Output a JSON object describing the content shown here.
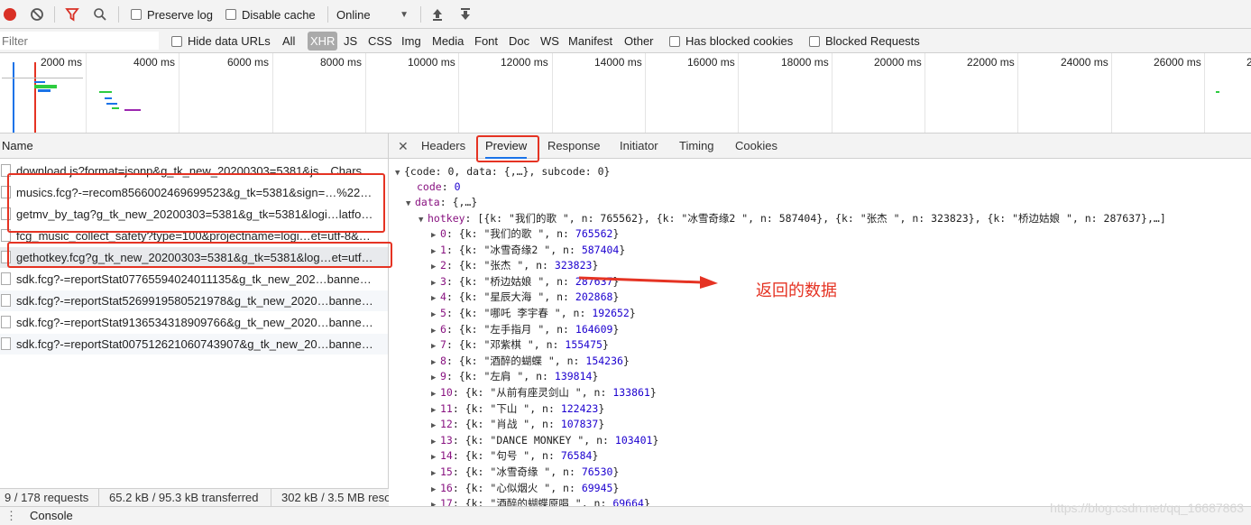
{
  "toolbar": {
    "preserve_log": "Preserve log",
    "disable_cache": "Disable cache",
    "throttle": "Online"
  },
  "filter": {
    "placeholder": "Filter",
    "hide_data_urls": "Hide data URLs",
    "types": [
      "All",
      "XHR",
      "JS",
      "CSS",
      "Img",
      "Media",
      "Font",
      "Doc",
      "WS",
      "Manifest",
      "Other"
    ],
    "active_type": "XHR",
    "has_blocked_cookies": "Has blocked cookies",
    "blocked_requests": "Blocked Requests"
  },
  "overview": {
    "ticks": [
      "2000 ms",
      "4000 ms",
      "6000 ms",
      "8000 ms",
      "10000 ms",
      "12000 ms",
      "14000 ms",
      "16000 ms",
      "18000 ms",
      "20000 ms",
      "22000 ms",
      "24000 ms",
      "26000 ms",
      "2"
    ]
  },
  "requests": {
    "header": "Name",
    "rows": [
      "download.js?format=jsonp&g_tk_new_20200303=5381&js…Chars…",
      "musics.fcg?-=recom8566002469699523&g_tk=5381&sign=…%22…",
      "getmv_by_tag?g_tk_new_20200303=5381&g_tk=5381&logi…latfo…",
      "fcg_music_collect_safety?type=100&projectname=logi…et=utf-8&…",
      "gethotkey.fcg?g_tk_new_20200303=5381&g_tk=5381&log…et=utf…",
      "sdk.fcg?-=reportStat07765594024011135&g_tk_new_202…banne…",
      "sdk.fcg?-=reportStat5269919580521978&g_tk_new_2020…banne…",
      "sdk.fcg?-=reportStat9136534318909766&g_tk_new_2020…banne…",
      "sdk.fcg?-=reportStat007512621060743907&g_tk_new_20…banne…"
    ]
  },
  "status": {
    "requests": "9 / 178 requests",
    "transferred": "65.2 kB / 95.3 kB transferred",
    "resources": "302 kB / 3.5 MB resources"
  },
  "detail_tabs": [
    "Headers",
    "Preview",
    "Response",
    "Initiator",
    "Timing",
    "Cookies"
  ],
  "active_tab": "Preview",
  "preview": {
    "root": "{code: 0, data: {,…}, subcode: 0}",
    "code_key": "code",
    "code_val": "0",
    "data_key": "data",
    "data_val": "{,…}",
    "hotkey_key": "hotkey",
    "hotkey_val": "[{k: \"我们的歌 \", n: 765562}, {k: \"冰雪奇缘2 \", n: 587404}, {k: \"张杰 \", n: 323823}, {k: \"桥边姑娘 \", n: 287637},…]",
    "items": [
      {
        "i": "0",
        "k": "我们的歌 ",
        "n": "765562"
      },
      {
        "i": "1",
        "k": "冰雪奇缘2 ",
        "n": "587404"
      },
      {
        "i": "2",
        "k": "张杰 ",
        "n": "323823"
      },
      {
        "i": "3",
        "k": "桥边姑娘 ",
        "n": "287637"
      },
      {
        "i": "4",
        "k": "星辰大海 ",
        "n": "202868"
      },
      {
        "i": "5",
        "k": "哪吒 李宇春 ",
        "n": "192652"
      },
      {
        "i": "6",
        "k": "左手指月 ",
        "n": "164609"
      },
      {
        "i": "7",
        "k": "邓紫棋 ",
        "n": "155475"
      },
      {
        "i": "8",
        "k": "酒醉的蝴蝶 ",
        "n": "154236"
      },
      {
        "i": "9",
        "k": "左肩 ",
        "n": "139814"
      },
      {
        "i": "10",
        "k": "从前有座灵剑山 ",
        "n": "133861"
      },
      {
        "i": "11",
        "k": "下山 ",
        "n": "122423"
      },
      {
        "i": "12",
        "k": "肖战 ",
        "n": "107837"
      },
      {
        "i": "13",
        "k": "DANCE MONKEY ",
        "n": "103401"
      },
      {
        "i": "14",
        "k": "句号 ",
        "n": "76584"
      },
      {
        "i": "15",
        "k": "冰雪奇缘 ",
        "n": "76530"
      },
      {
        "i": "16",
        "k": "心似烟火 ",
        "n": "69945"
      },
      {
        "i": "17",
        "k": "酒醉的蝴蝶原唱 ",
        "n": "69664"
      }
    ]
  },
  "annotation": "返回的数据",
  "console_label": "Console",
  "watermark": "https://blog.csdn.net/qq_16687863",
  "colors": {
    "accent": "#1a73e8",
    "record": "#d93025",
    "annotation": "#e53323"
  }
}
